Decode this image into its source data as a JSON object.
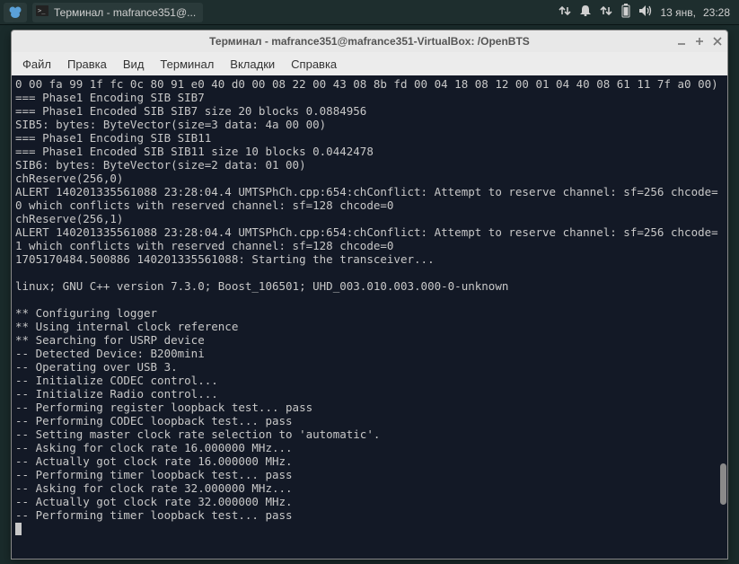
{
  "panel": {
    "taskbar_label": "Терминал - mafrance351@...",
    "date": "13 янв,",
    "time": "23:28"
  },
  "window": {
    "title": "Терминал - mafrance351@mafrance351-VirtualBox: /OpenBTS"
  },
  "menu": {
    "file": "Файл",
    "edit": "Правка",
    "view": "Вид",
    "terminal": "Терминал",
    "tabs": "Вкладки",
    "help": "Справка"
  },
  "terminal_lines": [
    "0 00 fa 99 1f fc 0c 80 91 e0 40 d0 00 08 22 00 43 08 8b fd 00 04 18 08 12 00 01 04 40 08 61 11 7f a0 00)",
    "=== Phase1 Encoding SIB SIB7",
    "=== Phase1 Encoded SIB SIB7 size 20 blocks 0.0884956",
    "SIB5: bytes: ByteVector(size=3 data: 4a 00 00)",
    "=== Phase1 Encoding SIB SIB11",
    "=== Phase1 Encoded SIB SIB11 size 10 blocks 0.0442478",
    "SIB6: bytes: ByteVector(size=2 data: 01 00)",
    "chReserve(256,0)",
    "ALERT 140201335561088 23:28:04.4 UMTSPhCh.cpp:654:chConflict: Attempt to reserve channel: sf=256 chcode=0 which conflicts with reserved channel: sf=128 chcode=0",
    "chReserve(256,1)",
    "ALERT 140201335561088 23:28:04.4 UMTSPhCh.cpp:654:chConflict: Attempt to reserve channel: sf=256 chcode=1 which conflicts with reserved channel: sf=128 chcode=0",
    "1705170484.500886 140201335561088: Starting the transceiver...",
    "",
    "linux; GNU C++ version 7.3.0; Boost_106501; UHD_003.010.003.000-0-unknown",
    "",
    "** Configuring logger",
    "** Using internal clock reference",
    "** Searching for USRP device",
    "-- Detected Device: B200mini",
    "-- Operating over USB 3.",
    "-- Initialize CODEC control...",
    "-- Initialize Radio control...",
    "-- Performing register loopback test... pass",
    "-- Performing CODEC loopback test... pass",
    "-- Setting master clock rate selection to 'automatic'.",
    "-- Asking for clock rate 16.000000 MHz...",
    "-- Actually got clock rate 16.000000 MHz.",
    "-- Performing timer loopback test... pass",
    "-- Asking for clock rate 32.000000 MHz...",
    "-- Actually got clock rate 32.000000 MHz.",
    "-- Performing timer loopback test... pass"
  ]
}
